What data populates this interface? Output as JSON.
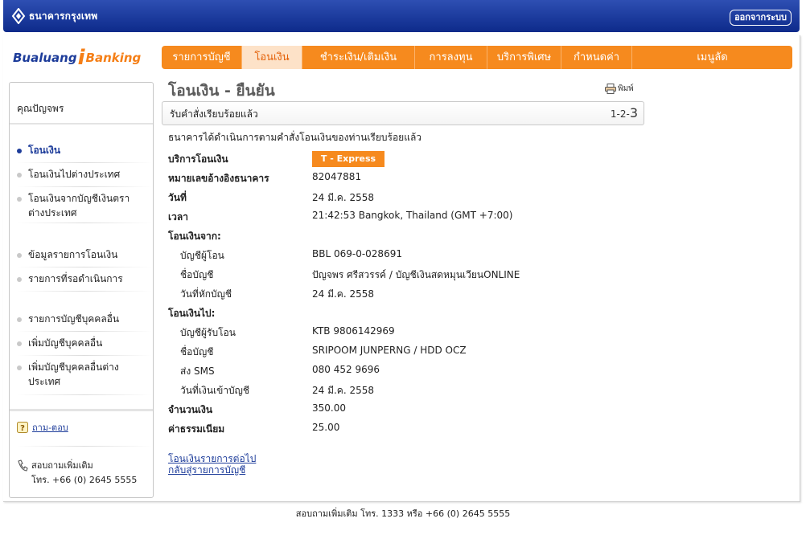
{
  "header": {
    "bank_name": "ธนาคารกรุงเทพ",
    "logout_label": "ออกจากระบบ"
  },
  "brand": {
    "part1": "Bualuang",
    "part_i": "i",
    "part2": "Banking"
  },
  "nav": {
    "items": [
      {
        "label": "รายการบัญชี"
      },
      {
        "label": "โอนเงิน"
      },
      {
        "label": "ชำระเงิน/เติมเงิน"
      },
      {
        "label": "การลงทุน"
      },
      {
        "label": "บริการพิเศษ"
      },
      {
        "label": "กำหนดค่า"
      },
      {
        "label": "เมนูลัด"
      }
    ],
    "active_index": 1
  },
  "sidebar": {
    "title": "คุณปัญจพร",
    "items": [
      {
        "label": "โอนเงิน"
      },
      {
        "label": "โอนเงินไปต่างประเทศ"
      },
      {
        "label": "โอนเงินจากบัญชีเงินตราต่างประเทศ"
      },
      {
        "label": "ข้อมูลรายการโอนเงิน"
      },
      {
        "label": "รายการที่รอดำเนินการ"
      },
      {
        "label": "รายการบัญชีบุคคลอื่น"
      },
      {
        "label": "เพิ่มบัญชีบุคคลอื่น"
      },
      {
        "label": "เพิ่มบัญชีบุคคลอื่นต่างประเทศ"
      }
    ],
    "faq_label": "ถาม-ตอบ",
    "contact_line1": "สอบถามเพิ่มเติม",
    "contact_line2": "โทร. +66 (0) 2645 5555"
  },
  "main": {
    "title": "โอนเงิน - ยืนยัน",
    "print_label": "พิมพ์",
    "status": "รับคำสั่งเรียบร้อยแล้ว",
    "steps_prefix": "1-2-",
    "steps_current": "3",
    "message": "ธนาคารได้ดำเนินการตามคำสั่งโอนเงินของท่านเรียบร้อยแล้ว",
    "service_label": "บริการโอนเงิน",
    "service_value": "T - Express",
    "ref_label": "หมายเลขอ้างอิงธนาคาร",
    "ref_value": "82047881",
    "date_label": "วันที่",
    "date_value": "24 มี.ค. 2558",
    "time_label": "เวลา",
    "time_value": "21:42:53 Bangkok, Thailand (GMT +7:00)",
    "from_heading": "โอนเงินจาก:",
    "from_account_label": "บัญชีผู้โอน",
    "from_account_value": "BBL 069-0-028691",
    "from_name_label": "ชื่อบัญชี",
    "from_name_value": "ปัญจพร ศรีสวรรค์ / บัญชีเงินสดหมุนเวียนONLINE",
    "debit_date_label": "วันที่หักบัญชี",
    "debit_date_value": "24 มี.ค. 2558",
    "to_heading": "โอนเงินไป:",
    "to_account_label": "บัญชีผู้รับโอน",
    "to_account_value": "KTB 9806142969",
    "to_name_label": "ชื่อบัญชี",
    "to_name_value": "SRIPOOM JUNPERNG / HDD OCZ",
    "sms_label": "ส่ง SMS",
    "sms_value": "080 452 9696",
    "credit_date_label": "วันที่เงินเข้าบัญชี",
    "credit_date_value": "24 มี.ค. 2558",
    "amount_label": "จำนวนเงิน",
    "amount_value": "350.00",
    "fee_label": "ค่าธรรมเนียม",
    "fee_value": "25.00",
    "link_next": "โอนเงินรายการต่อไป",
    "link_back": "กลับสู่รายการบัญชี"
  },
  "footer": {
    "text": "สอบถามเพิ่มเติม โทร. 1333 หรือ +66 (0) 2645 5555"
  },
  "colors": {
    "nav_orange": "#f68a1e",
    "header_blue": "#0d2a8a",
    "link_blue": "#1d3c9a"
  }
}
